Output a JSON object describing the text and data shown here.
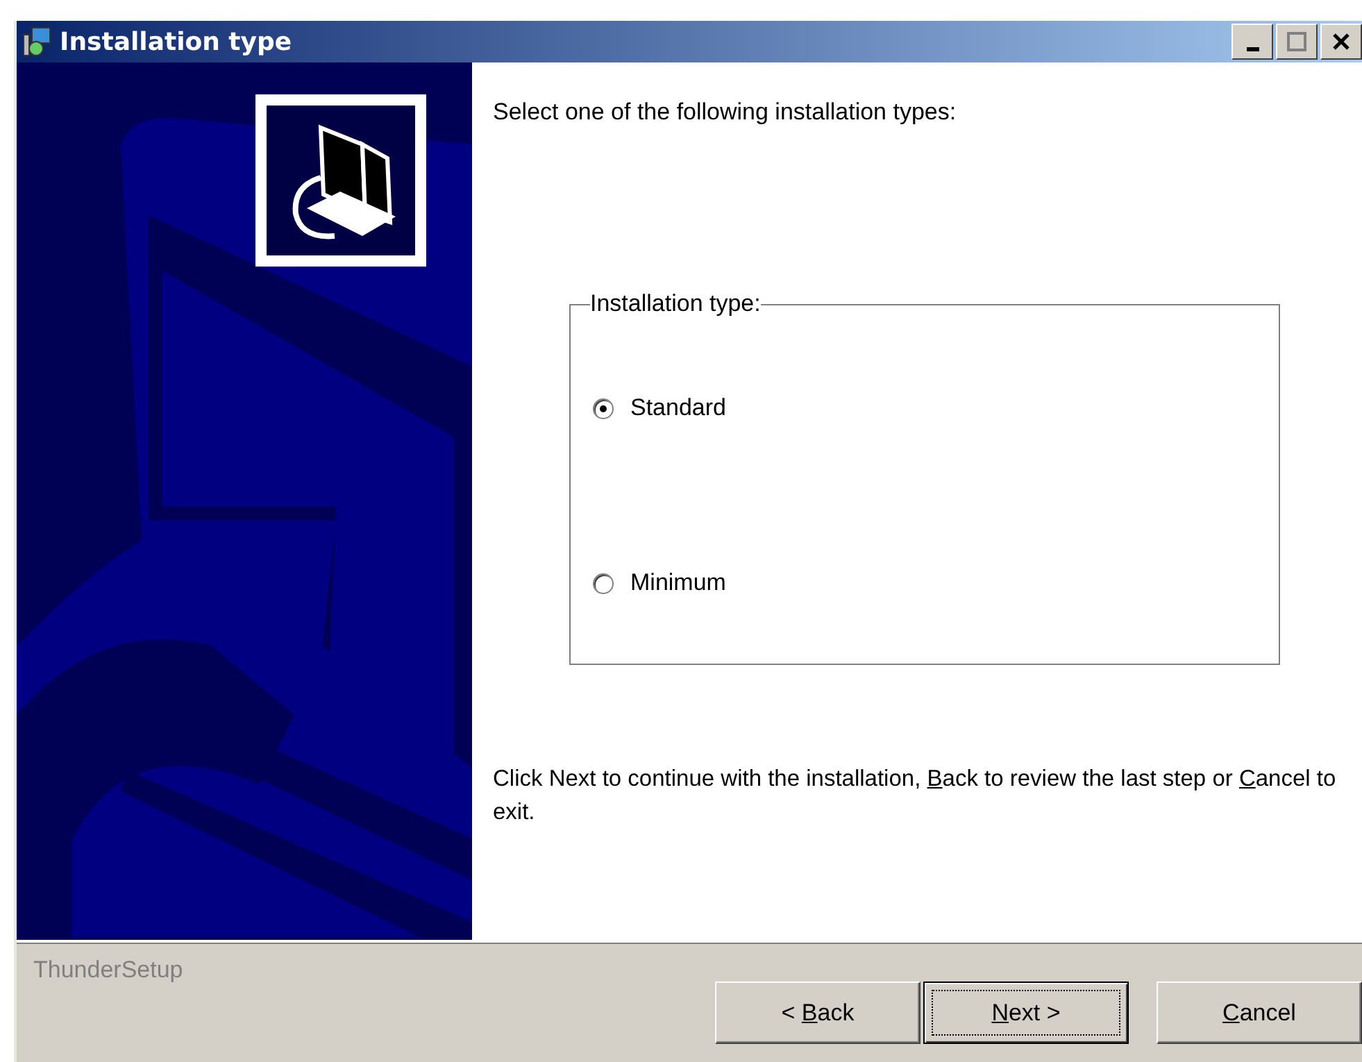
{
  "window": {
    "title": "Installation type",
    "controls": [
      {
        "kind": "minimize"
      },
      {
        "kind": "maximize"
      },
      {
        "kind": "close"
      }
    ]
  },
  "heading": "Select one of the following installation types:",
  "group": {
    "label": "Installation type:",
    "options": [
      {
        "label": "Standard",
        "selected": true
      },
      {
        "label": "Minimum",
        "selected": false
      }
    ]
  },
  "instructions": [
    {
      "text": "Click Next to continue with the installation, "
    },
    {
      "text": "B",
      "underline": true
    },
    {
      "text": "ack to review the last step or "
    },
    {
      "text": "C",
      "underline": true
    },
    {
      "text": "ancel to exit."
    }
  ],
  "footer": {
    "brand": "ThunderSetup",
    "buttons": [
      {
        "parts": [
          {
            "text": "< "
          },
          {
            "text": "B",
            "underline": true
          },
          {
            "text": "ack"
          }
        ],
        "focused": false
      },
      {
        "parts": [
          {
            "text": "N",
            "underline": true
          },
          {
            "text": "ext >"
          }
        ],
        "focused": true
      },
      {
        "parts": [
          {
            "text": "C",
            "underline": true
          },
          {
            "text": "ancel"
          }
        ],
        "focused": false
      }
    ]
  }
}
